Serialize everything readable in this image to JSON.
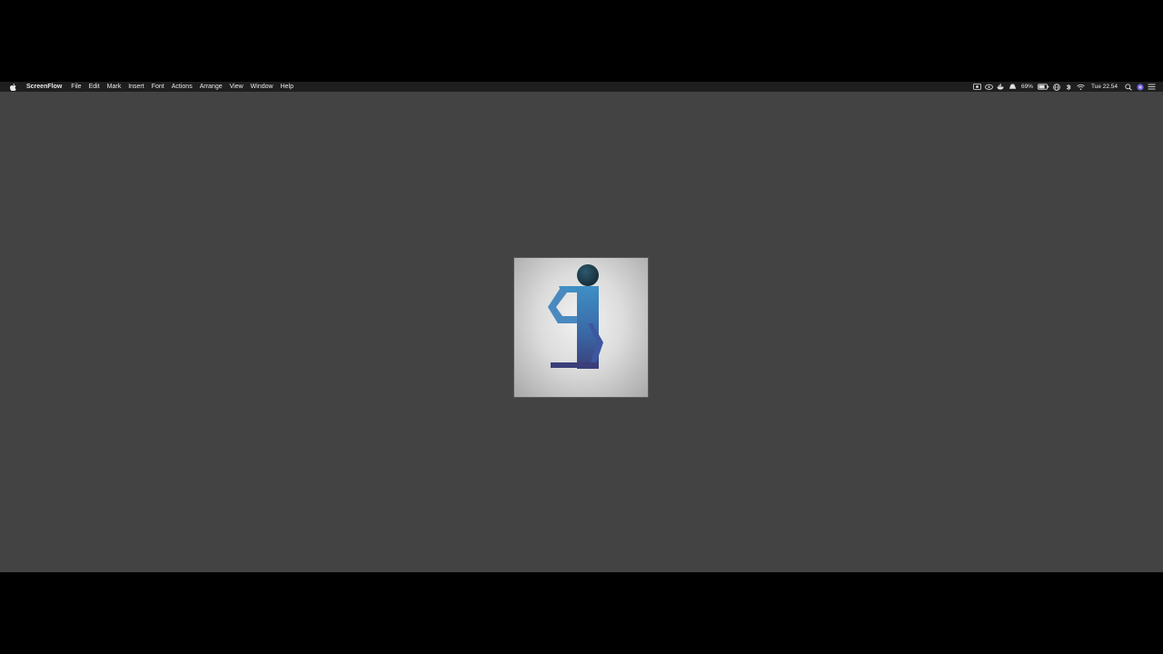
{
  "menubar": {
    "apple_icon": "apple-logo-icon",
    "app_name": "ScreenFlow",
    "menus": [
      "File",
      "Edit",
      "Mark",
      "Insert",
      "Font",
      "Actions",
      "Arrange",
      "View",
      "Window",
      "Help"
    ],
    "status": {
      "battery_percent": "69%",
      "clock": "Tue 22.54"
    }
  },
  "desktop": {
    "background_color": "#434343",
    "logo_thumbnail": {
      "icon": "stylized-figure-logo",
      "colors": {
        "head": "#1d3f4f",
        "body_top": "#3f8fc4",
        "body_bottom": "#3a3f7a"
      }
    }
  }
}
